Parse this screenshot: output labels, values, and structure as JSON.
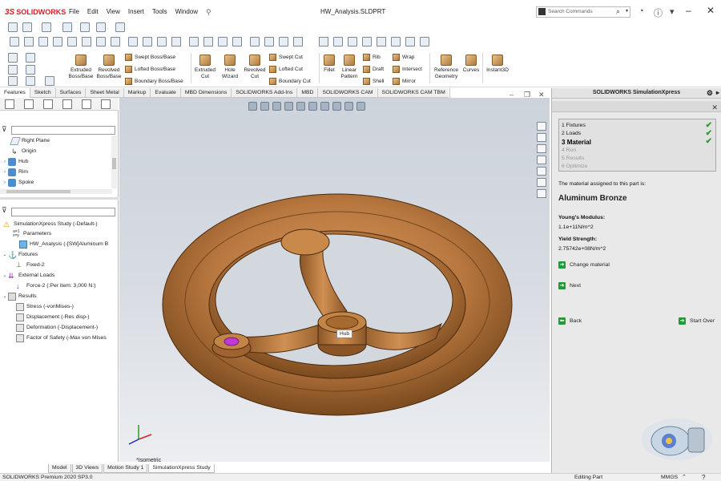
{
  "app": {
    "logo_ds": "3S",
    "logo_name": "SOLIDWORKS",
    "menu": [
      "File",
      "Edit",
      "View",
      "Insert",
      "Tools",
      "Window"
    ],
    "doc_title": "HW_Analysis.SLDPRT",
    "search_placeholder": "Search Commands"
  },
  "ribbon": {
    "extruded_boss": "Extruded Boss/Base",
    "revolved_boss": "Revolved Boss/Base",
    "swept_boss": "Swept Boss/Base",
    "lofted_boss": "Lofted Boss/Base",
    "boundary_boss": "Boundary Boss/Base",
    "extruded_cut": "Extruded Cut",
    "hole_wizard": "Hole Wizard",
    "revolved_cut": "Revolved Cut",
    "swept_cut": "Swept Cut",
    "lofted_cut": "Lofted Cut",
    "boundary_cut": "Boundary Cut",
    "fillet": "Fillet",
    "linear_pattern": "Linear Pattern",
    "rib": "Rib",
    "draft": "Draft",
    "shell": "Shell",
    "wrap": "Wrap",
    "intersect": "Intersect",
    "mirror": "Mirror",
    "reference_geometry": "Reference Geometry",
    "curves": "Curves",
    "instant3d": "Instant3D"
  },
  "tabs": [
    "Features",
    "Sketch",
    "Surfaces",
    "Sheet Metal",
    "Markup",
    "Evaluate",
    "MBD Dimensions",
    "SOLIDWORKS Add-Ins",
    "MBD",
    "SOLIDWORKS CAM",
    "SOLIDWORKS CAM TBM"
  ],
  "feature_tree": {
    "items": [
      "Right Plane",
      "Origin",
      "Hub",
      "Rim",
      "Spoke"
    ]
  },
  "study_tree": {
    "study": "SimulationXpress Study (-Default-)",
    "parameters": "Parameters",
    "part": "HW_Analysis (-[SW]Aluminum B",
    "fixtures": "Fixtures",
    "fixed": "Fixed-2",
    "external_loads": "External Loads",
    "force": "Force-2 (:Per item: 3,000 N:)",
    "results": "Results",
    "stress": "Stress (-vonMises-)",
    "displacement": "Displacement (-Res disp-)",
    "deformation": "Deformation (-Displacement-)",
    "fos": "Factor of Safety (-Max von Mises"
  },
  "graphics": {
    "view_label": "*Isometric",
    "hub_tooltip": "Hub",
    "wheel_color": "#b8773f"
  },
  "bottom_tabs": [
    "Model",
    "3D Views",
    "Motion Study 1",
    "SimulationXpress Study"
  ],
  "status": {
    "version": "SOLIDWORKS Premium 2020 SP3.0",
    "mode": "Editing Part",
    "units": "MMGS"
  },
  "sim": {
    "title": "SOLIDWORKS SimulationXpress",
    "steps": [
      {
        "n": "1",
        "label": "Fixtures"
      },
      {
        "n": "2",
        "label": "Loads"
      },
      {
        "n": "3",
        "label": "Material"
      },
      {
        "n": "4",
        "label": "Run"
      },
      {
        "n": "5",
        "label": "Results"
      },
      {
        "n": "6",
        "label": "Optimize"
      }
    ],
    "assigned_text": "The material assigned to this part is:",
    "material": "Aluminum Bronze",
    "youngs_label": "Young's Modulus:",
    "youngs_value": "1.1e+11N/m^2",
    "yield_label": "Yield Strength:",
    "yield_value": "2.75742e+08N/m^2",
    "change_material": "Change material",
    "next": "Next",
    "back": "Back",
    "start_over": "Start Over"
  }
}
